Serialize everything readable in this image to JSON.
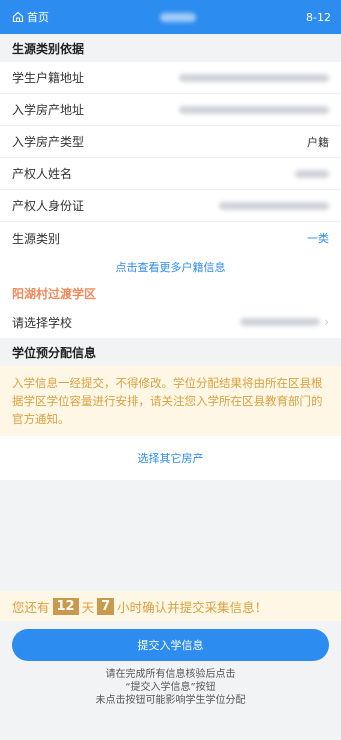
{
  "header": {
    "home_label": "首页",
    "date": "8-12"
  },
  "source_section": {
    "title": "生源类别依据",
    "rows": [
      {
        "label": "学生户籍地址",
        "value": ""
      },
      {
        "label": "入学房产地址",
        "value": ""
      },
      {
        "label": "入学房产类型",
        "value": "户籍"
      },
      {
        "label": "产权人姓名",
        "value": ""
      },
      {
        "label": "产权人身份证",
        "value": ""
      },
      {
        "label": "生源类别",
        "value": "一类"
      }
    ],
    "more_link": "点击查看更多户籍信息"
  },
  "district": {
    "name": "阳湖村过渡学区",
    "select_label": "请选择学校"
  },
  "allocation": {
    "title": "学位预分配信息",
    "notice": "入学信息一经提交，不得修改。学位分配结果将由所在区县根据学区学位容量进行安排，请关注您入学所在区县教育部门的官方通知。",
    "other_link": "选择其它房产"
  },
  "countdown": {
    "prefix": "您还有",
    "days": "12",
    "day_unit": "天",
    "hours": "7",
    "suffix": "小时确认并提交采集信息！"
  },
  "submit": {
    "label": "提交入学信息"
  },
  "hint": {
    "line1": "请在完成所有信息核验后点击",
    "line2": "“提交入学信息”按钮",
    "line3": "未点击按钮可能影响学生学位分配"
  }
}
